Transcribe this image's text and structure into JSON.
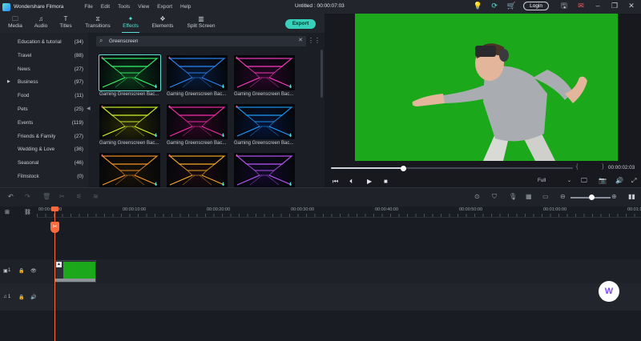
{
  "app": {
    "name": "Wondershare Filmora",
    "doc_title": "Untitled : 00:00:07:03"
  },
  "menu": [
    "File",
    "Edit",
    "Tools",
    "View",
    "Export",
    "Help"
  ],
  "titlebar": {
    "login_label": "Login"
  },
  "tabs": [
    {
      "label": "Media",
      "icon": "folder-icon"
    },
    {
      "label": "Audio",
      "icon": "music-note-icon"
    },
    {
      "label": "Titles",
      "icon": "text-icon"
    },
    {
      "label": "Transitions",
      "icon": "transitions-icon"
    },
    {
      "label": "Effects",
      "icon": "effects-icon",
      "active": true
    },
    {
      "label": "Elements",
      "icon": "elements-icon"
    },
    {
      "label": "Split Screen",
      "icon": "split-screen-icon"
    }
  ],
  "export_label": "Export",
  "categories": [
    {
      "label": "Education & tutorial",
      "count": "(34)"
    },
    {
      "label": "Travel",
      "count": "(88)"
    },
    {
      "label": "News",
      "count": "(27)"
    },
    {
      "label": "Business",
      "count": "(97)",
      "expandable": true
    },
    {
      "label": "Food",
      "count": "(11)"
    },
    {
      "label": "Pets",
      "count": "(25)"
    },
    {
      "label": "Events",
      "count": "(119)"
    },
    {
      "label": "Friends & Family",
      "count": "(27)"
    },
    {
      "label": "Wedding & Love",
      "count": "(36)"
    },
    {
      "label": "Seasonal",
      "count": "(46)"
    },
    {
      "label": "Filmstock",
      "count": "(0)"
    }
  ],
  "search": {
    "value": "Greenscreen"
  },
  "effects": [
    {
      "label": "Gaming Greenscreen Bac...",
      "selected": true
    },
    {
      "label": "Gaming Greenscreen Bac..."
    },
    {
      "label": "Gaming Greenscreen Bac..."
    },
    {
      "label": "Gaming Greenscreen Bac..."
    },
    {
      "label": "Gaming Greenscreen Bac..."
    },
    {
      "label": "Gaming Greenscreen Bac..."
    },
    {
      "label": ""
    },
    {
      "label": ""
    },
    {
      "label": ""
    }
  ],
  "preview": {
    "timecode": "00:00:02:03",
    "progress": 0.3,
    "quality": "Full",
    "brackets": "{ }"
  },
  "timeline": {
    "ruler_labels": [
      "00:00:00:00",
      "00:00:10:00",
      "00:00:20:00",
      "00:00:30:00",
      "00:00:40:00",
      "00:00:50:00",
      "00:01:00:00",
      "00:01:10:00"
    ],
    "video_track": "1",
    "audio_track": "1"
  },
  "colors": {
    "accent": "#5ee1d6",
    "export": "#38d0b9",
    "playhead": "#ff6b3d",
    "greenscreen": "#1ba81b"
  }
}
